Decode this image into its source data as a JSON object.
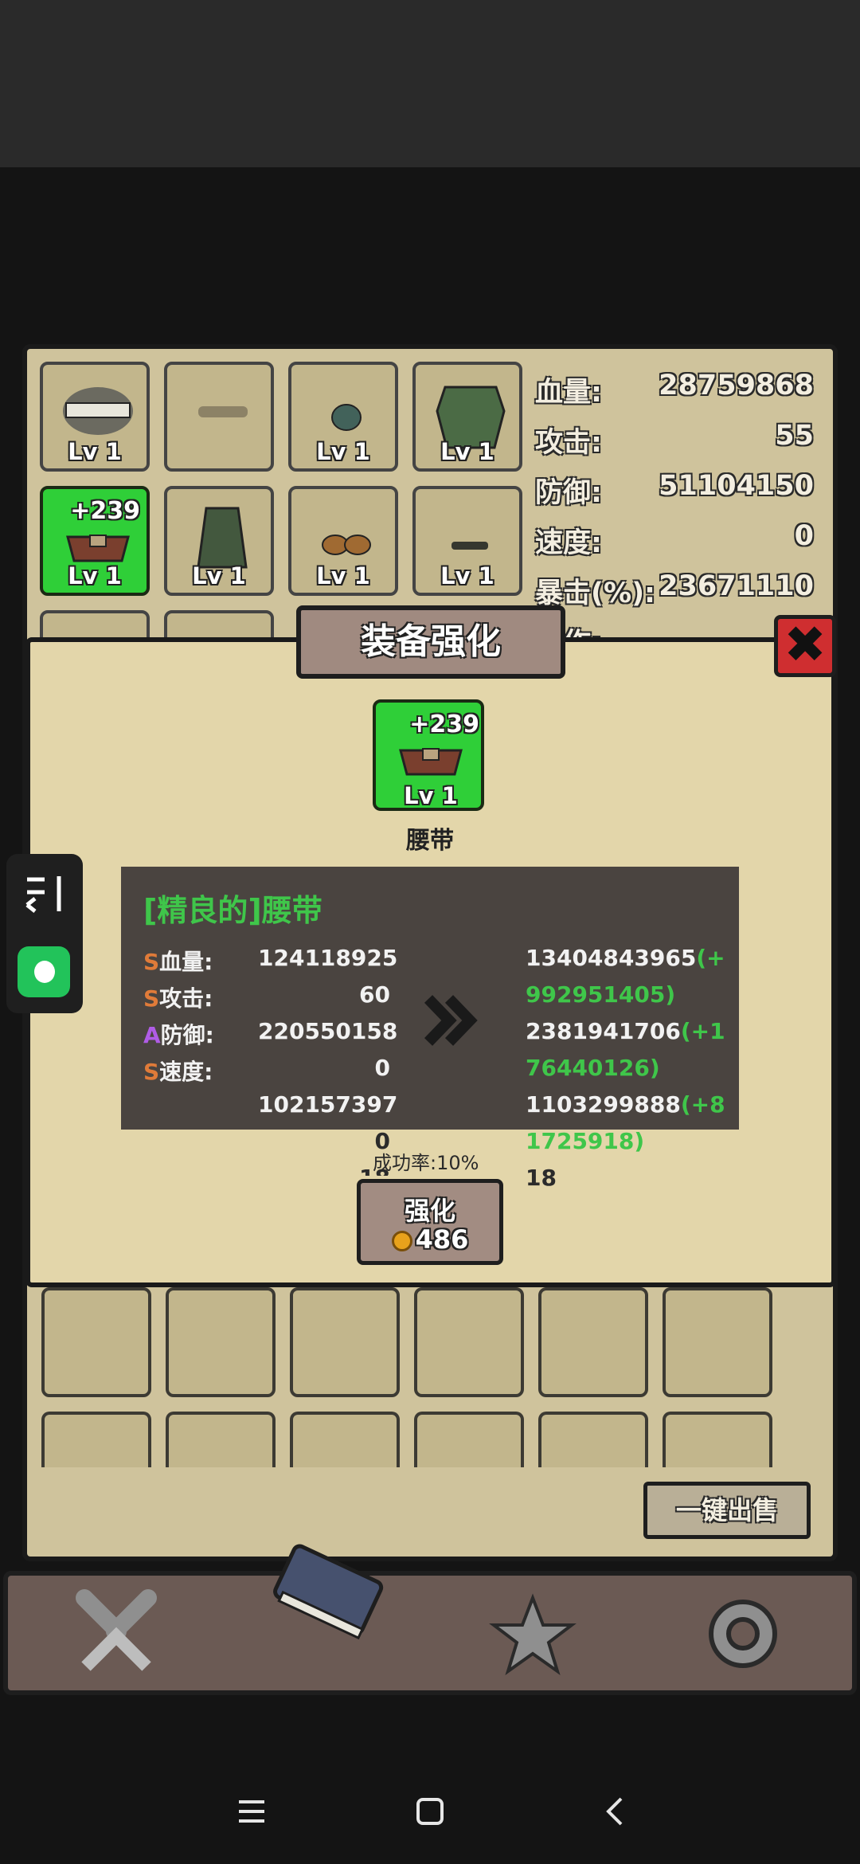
{
  "inventory": {
    "slots": [
      {
        "item": "headband",
        "level": "Lv 1"
      },
      {
        "item": "mask",
        "level": ""
      },
      {
        "item": "gem",
        "level": "Lv 1"
      },
      {
        "item": "armor",
        "level": "Lv 1"
      },
      {
        "item": "belt",
        "level": "Lv 1",
        "bonus": "+239",
        "selected": true
      },
      {
        "item": "cloak",
        "level": "Lv 1"
      },
      {
        "item": "boots",
        "level": "Lv 1"
      },
      {
        "item": "bracer",
        "level": "Lv 1"
      }
    ],
    "sell_all_label": "一键出售"
  },
  "stats": [
    {
      "label": "血量:",
      "value": "28759868"
    },
    {
      "label": "攻击:",
      "value": "55"
    },
    {
      "label": "防御:",
      "value": "51104150"
    },
    {
      "label": "速度:",
      "value": "0"
    },
    {
      "label": "暴击(%):",
      "value": "23671110"
    },
    {
      "label": "…作:",
      "value": ""
    }
  ],
  "modal": {
    "title": "装备强化",
    "item": {
      "bonus": "+239",
      "level": "Lv 1",
      "name": "腰带"
    },
    "item_title": "[精良的]腰带",
    "rows": [
      {
        "rank": "S",
        "rank_color": "#e07b39",
        "label": "血量:",
        "current": "124118925",
        "next": "13404843965",
        "delta": "(+992951405)"
      },
      {
        "rank": "S",
        "rank_color": "#e07b39",
        "label": "攻击:",
        "current": "60",
        "next": "2381941706",
        "delta": "(+176440126)"
      },
      {
        "rank": "A",
        "rank_color": "#b05ce6",
        "label": "防御:",
        "current": "220550158",
        "next": "1103299888",
        "delta": "(+81725918)"
      },
      {
        "rank": "S",
        "rank_color": "#e07b39",
        "label": "速度:",
        "current": "0",
        "next": "18",
        "delta": ""
      },
      {
        "rank": "",
        "rank_color": "",
        "label": "",
        "current": "102157397",
        "next": "",
        "delta": ""
      },
      {
        "rank": "",
        "rank_color": "",
        "label": "",
        "current": "0",
        "next": "",
        "delta": ""
      },
      {
        "rank": "",
        "rank_color": "",
        "label": "",
        "current": "18",
        "next": "",
        "delta": ""
      }
    ],
    "next_lines": [
      {
        "text": "13404843965",
        "delta": "(+"
      },
      {
        "text": "",
        "delta": "992951405)"
      },
      {
        "text": "2381941706",
        "delta": "(+1"
      },
      {
        "text": "",
        "delta": "76440126)"
      },
      {
        "text": "1103299888",
        "delta": "(+8"
      },
      {
        "text": "",
        "delta": "1725918)"
      },
      {
        "text": "18",
        "delta": ""
      }
    ],
    "success_rate": "成功率:10%",
    "enhance_label": "强化",
    "cost": "486"
  },
  "nav": [
    "battle-icon",
    "book-icon",
    "star-icon",
    "settings-icon"
  ],
  "colors": {
    "panel": "#cfc39c",
    "green_slot": "#2fcf38",
    "close_red": "#cf2e30",
    "info_bg": "#4a4440"
  }
}
